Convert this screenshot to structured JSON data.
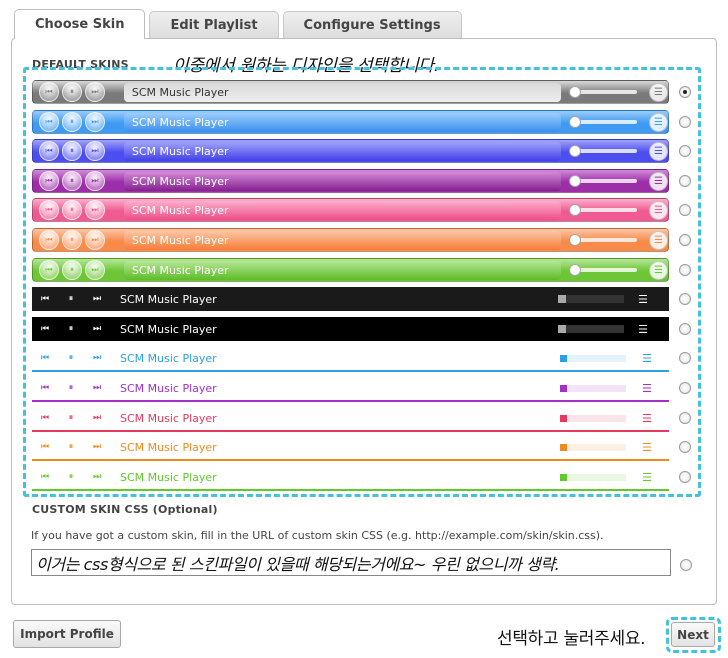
{
  "tabs": [
    {
      "label": "Choose Skin"
    },
    {
      "label": "Edit Playlist"
    },
    {
      "label": "Configure Settings"
    }
  ],
  "default_skins": {
    "heading": "DEFAULT SKINS",
    "annotation": "이중에서  원하는 디자인을 선택합니다.",
    "selected_index": 0,
    "skins": [
      {
        "style": "glossy",
        "title": "SCM Music Player",
        "color": "#7a7a7a",
        "light": "#d9d9d9",
        "text_color": "#333333",
        "title_bg": "#eeeeee"
      },
      {
        "style": "glossy",
        "title": "SCM Music Player",
        "color": "#3f9bf2",
        "light": "#9ccdfb",
        "text_color": "#ffffff",
        "title_bg": "#3a8ff0"
      },
      {
        "style": "glossy",
        "title": "SCM Music Player",
        "color": "#4d4ef0",
        "light": "#a0a2fb",
        "text_color": "#ffffff",
        "title_bg": "#4040e8"
      },
      {
        "style": "glossy",
        "title": "SCM Music Player",
        "color": "#9c2fa8",
        "light": "#d28ad9",
        "text_color": "#ffffff",
        "title_bg": "#84208e"
      },
      {
        "style": "glossy",
        "title": "SCM Music Player",
        "color": "#f05a93",
        "light": "#fbafca",
        "text_color": "#ffffff",
        "title_bg": "#ef4d88"
      },
      {
        "style": "glossy",
        "title": "SCM Music Player",
        "color": "#f88a4a",
        "light": "#fcc7a6",
        "text_color": "#ffffff",
        "title_bg": "#f77b36"
      },
      {
        "style": "glossy",
        "title": "SCM Music Player",
        "color": "#6dc636",
        "light": "#b6e698",
        "text_color": "#ffffff",
        "title_bg": "#5dbc26"
      },
      {
        "style": "dark",
        "title": "SCM Music Player",
        "color": "#1a1a1a"
      },
      {
        "style": "dark",
        "title": "SCM Music Player",
        "color": "#000000"
      },
      {
        "style": "flat",
        "title": "SCM Music Player",
        "color": "#2aa0e4"
      },
      {
        "style": "flat",
        "title": "SCM Music Player",
        "color": "#a52fc8"
      },
      {
        "style": "flat",
        "title": "SCM Music Player",
        "color": "#e7395e"
      },
      {
        "style": "flat",
        "title": "SCM Music Player",
        "color": "#f18a1c"
      },
      {
        "style": "flat",
        "title": "SCM Music Player",
        "color": "#62c92a"
      }
    ]
  },
  "custom_css": {
    "heading": "CUSTOM SKIN CSS (Optional)",
    "help": "If you have got a custom skin, fill in the URL of custom skin CSS (e.g. http://example.com/skin/skin.css).",
    "value": "이거는 css형식으로 된 스킨파일이 있을때 해당되는거에요~ 우린 없으니까 생략."
  },
  "footer": {
    "import_label": "Import Profile",
    "annotation": "선택하고 눌러주세요.",
    "next_label": "Next"
  },
  "icons": {
    "prev": "⏮",
    "pause": "⏸",
    "next": "⏭",
    "playlist": "☰"
  }
}
